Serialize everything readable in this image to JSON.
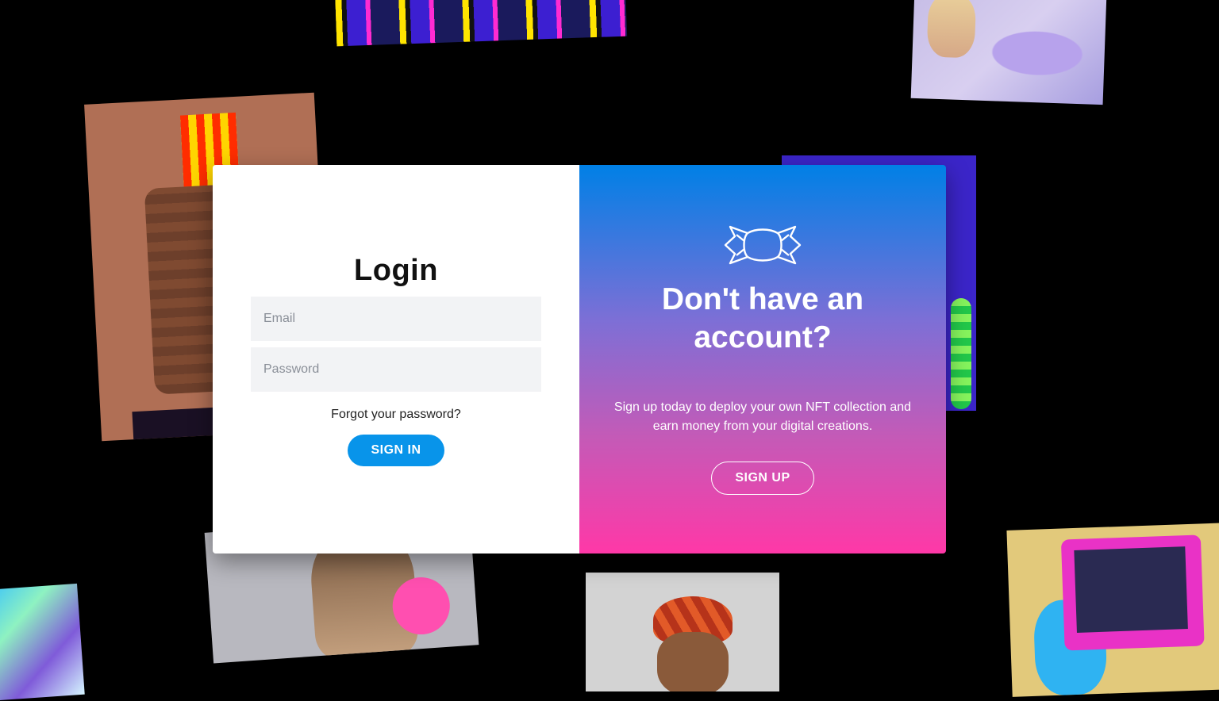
{
  "login": {
    "title": "Login",
    "email_placeholder": "Email",
    "password_placeholder": "Password",
    "forgot_label": "Forgot your password?",
    "signin_label": "SIGN IN"
  },
  "signup": {
    "icon": "candy-icon",
    "title": "Don't have an account?",
    "description": "Sign up today to deploy your own NFT collection and earn money from your digital creations.",
    "signup_label": "SIGN UP"
  },
  "colors": {
    "background": "#000000",
    "signin_button": "#0894ea",
    "gradient_top": "#0080e6",
    "gradient_bottom": "#ff38a7",
    "field_background": "#f2f3f5"
  }
}
